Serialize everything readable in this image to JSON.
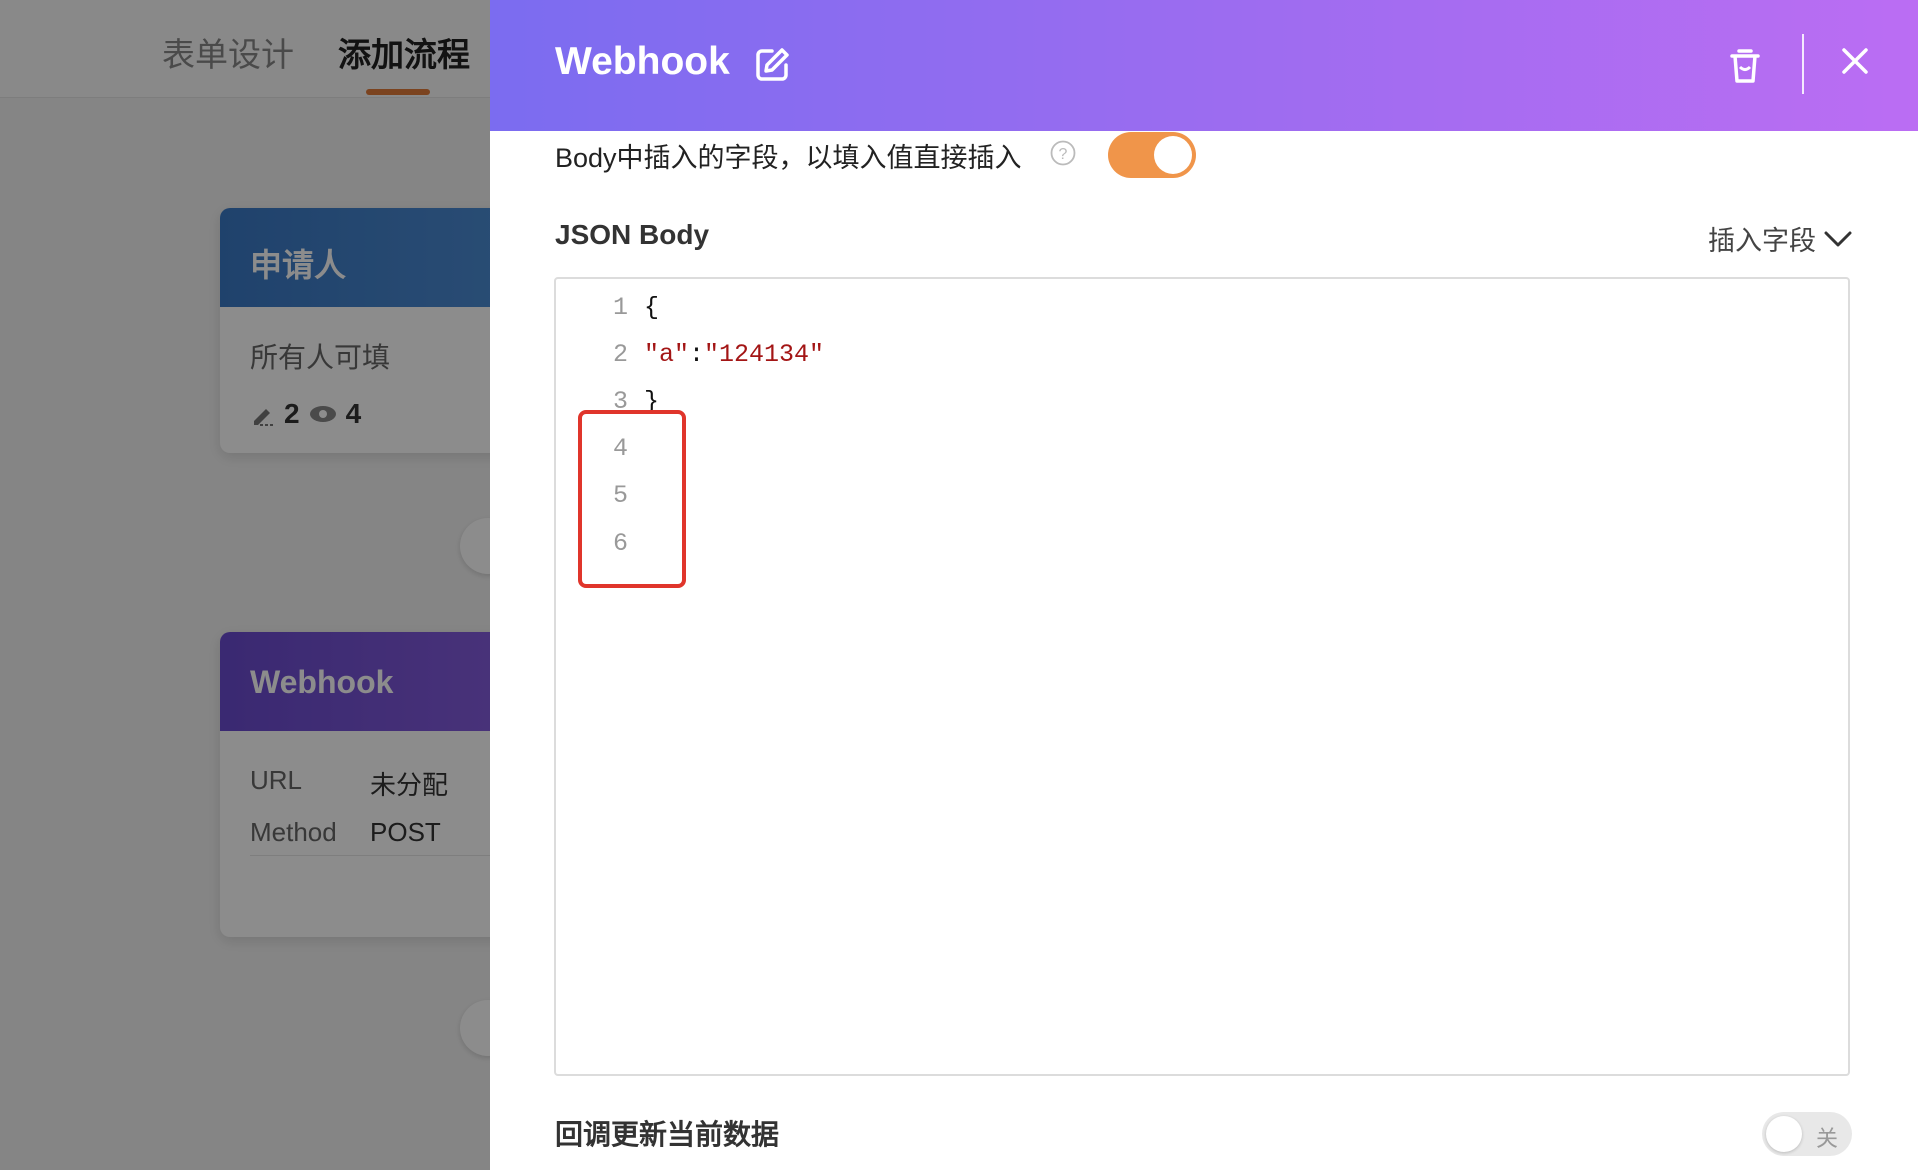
{
  "background": {
    "tabs": [
      {
        "label": "表单设计",
        "active": false
      },
      {
        "label": "添加流程",
        "active": true
      }
    ],
    "applicant_card": {
      "title": "申请人",
      "subtitle": "所有人可填",
      "edit_count": "2",
      "view_count": "4"
    },
    "webhook_card": {
      "title": "Webhook",
      "url_label": "URL",
      "url_value": "未分配",
      "method_label": "Method",
      "method_value": "POST"
    }
  },
  "drawer": {
    "title": "Webhook",
    "icons": {
      "edit": "edit-icon",
      "delete": "trash-icon",
      "close": "close-icon"
    },
    "insert_option": {
      "label": "Body中插入的字段，以填入值直接插入",
      "enabled": true
    },
    "json_body": {
      "label": "JSON Body",
      "insert_field_label": "插入字段",
      "lines": [
        {
          "number": "1",
          "text": "{"
        },
        {
          "number": "2",
          "key": "\"a\"",
          "colon": ":",
          "value": "\"124134\""
        },
        {
          "number": "3",
          "text": "}"
        },
        {
          "number": "4",
          "text": ""
        },
        {
          "number": "5",
          "text": ""
        },
        {
          "number": "6",
          "text": ""
        }
      ]
    },
    "callback_update": {
      "label": "回调更新当前数据",
      "enabled": false,
      "toggle_text": "关"
    }
  },
  "colors": {
    "header_gradient_start": "#7b6cf0",
    "header_gradient_end": "#bb6df3",
    "toggle_on": "#f0954a",
    "highlight": "#e0352b",
    "json_string": "#a31515"
  }
}
